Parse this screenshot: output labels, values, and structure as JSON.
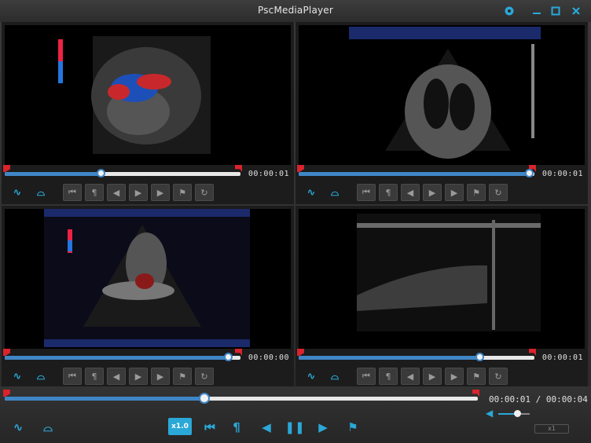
{
  "window": {
    "title": "PscMediaPlayer"
  },
  "panes": [
    {
      "id": "top-left",
      "time": "00:00:01",
      "progress": 0.41
    },
    {
      "id": "top-right",
      "time": "00:00:01",
      "progress": 0.98
    },
    {
      "id": "bottom-left",
      "time": "00:00:00",
      "progress": 0.95
    },
    {
      "id": "bottom-right",
      "time": "00:00:01",
      "progress": 0.77
    }
  ],
  "master": {
    "time": "00:00:01 / 00:00:04",
    "progress": 0.42,
    "speed_label": "x1.0",
    "volume": 0.6,
    "zoom_label": "x1"
  },
  "colors": {
    "accent": "#2aa8d8",
    "progress": "#3f86c6",
    "marker": "#d9232d"
  }
}
